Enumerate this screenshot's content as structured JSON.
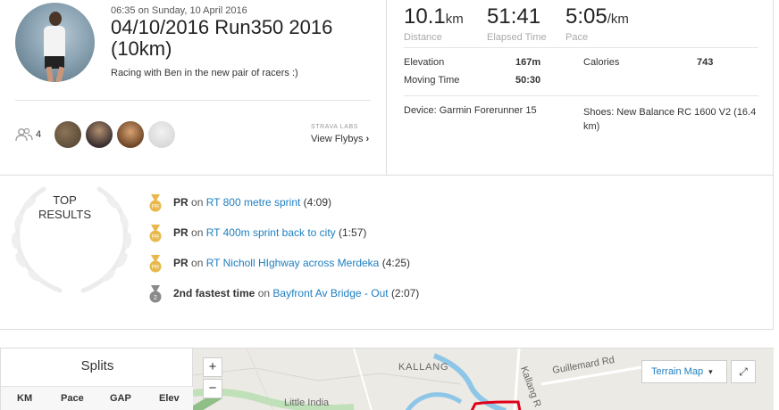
{
  "activity": {
    "timestamp": "06:35 on Sunday, 10 April 2016",
    "title_line1": "04/10/2016 Run350 2016",
    "title_line2": "(10km)",
    "description": "Racing with Ben in the new pair of racers :)"
  },
  "athletes": {
    "count": "4"
  },
  "flyby": {
    "labs_label": "STRAVA LABS",
    "link_label": "View Flybys",
    "chevron": "›"
  },
  "stats": [
    {
      "value": "10.1",
      "unit": "km",
      "label": "Distance"
    },
    {
      "value": "51:41",
      "unit": "",
      "label": "Elapsed Time"
    },
    {
      "value": "5:05",
      "unit": "/km",
      "label": "Pace"
    }
  ],
  "details": {
    "elevation_label": "Elevation",
    "elevation_value": "167m",
    "moving_time_label": "Moving Time",
    "moving_time_value": "50:30",
    "calories_label": "Calories",
    "calories_value": "743",
    "device": "Device: Garmin Forerunner 15",
    "shoes": "Shoes: New Balance RC 1600 V2 (16.4 km)"
  },
  "top_results": {
    "heading_line1": "TOP",
    "heading_line2": "RESULTS",
    "items": [
      {
        "medal": "PR",
        "prefix": "PR",
        "on": "on",
        "segment": "RT 800 metre sprint",
        "time": "(4:09)",
        "medal_color": "#e8b84a"
      },
      {
        "medal": "PR",
        "prefix": "PR",
        "on": "on",
        "segment": "RT 400m sprint back to city",
        "time": "(1:57)",
        "medal_color": "#e8b84a"
      },
      {
        "medal": "PR",
        "prefix": "PR",
        "on": "on",
        "segment": "RT Nicholl HIghway across Merdeka",
        "time": "(4:25)",
        "medal_color": "#e8b84a"
      },
      {
        "medal": "2",
        "prefix": "2nd fastest time",
        "on": "on",
        "segment": "Bayfront Av Bridge - Out",
        "time": "(2:07)",
        "medal_color": "#8a8a8a"
      }
    ]
  },
  "splits": {
    "title": "Splits",
    "columns": [
      "KM",
      "Pace",
      "GAP",
      "Elev"
    ]
  },
  "map": {
    "zoom_in": "+",
    "zoom_out": "−",
    "terrain_label": "Terrain Map",
    "terrain_caret": "▾",
    "fullscreen_icon": "⤢",
    "labels": {
      "kallang": "KALLANG",
      "guillemard": "Guillemard Rd",
      "kallang_road": "Kallang R",
      "little_india": "Little India"
    }
  },
  "colors": {
    "link": "#1d7fbf",
    "route": "#e0001b",
    "gold_medal": "#e8b84a",
    "silver_medal": "#8a8a8a"
  }
}
